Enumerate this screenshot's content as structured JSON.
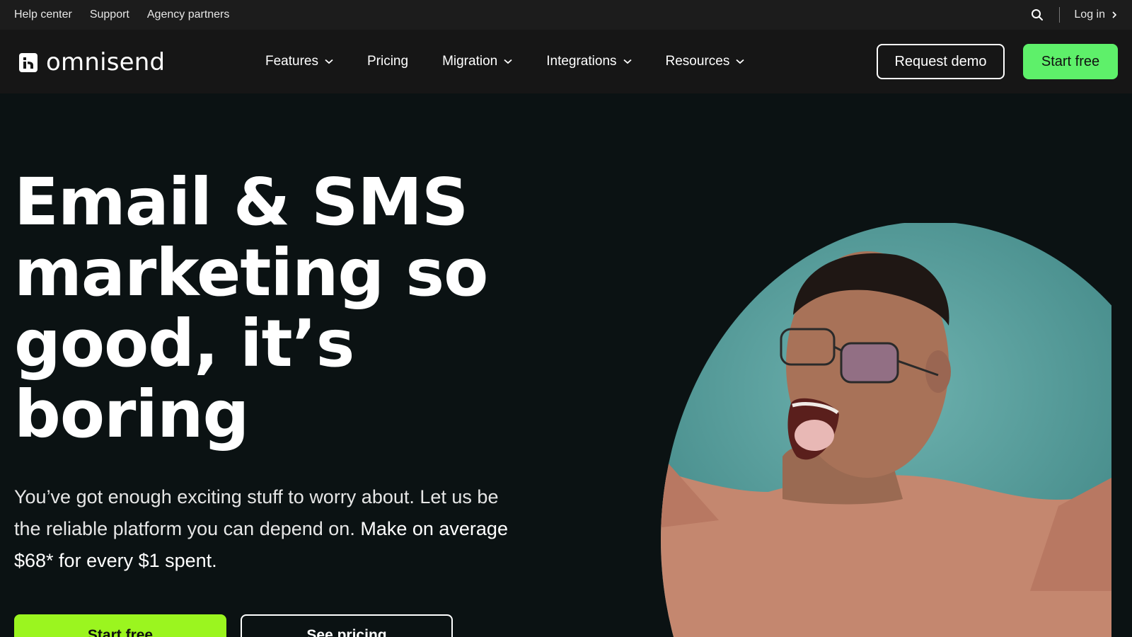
{
  "utility_bar": {
    "links": [
      "Help center",
      "Support",
      "Agency partners"
    ],
    "login_label": "Log in"
  },
  "nav": {
    "logo_text": "omnisend",
    "items": [
      {
        "label": "Features",
        "has_dropdown": true
      },
      {
        "label": "Pricing",
        "has_dropdown": false
      },
      {
        "label": "Migration",
        "has_dropdown": true
      },
      {
        "label": "Integrations",
        "has_dropdown": true
      },
      {
        "label": "Resources",
        "has_dropdown": true
      }
    ],
    "request_demo_label": "Request demo",
    "start_free_label": "Start free"
  },
  "hero": {
    "title_line1": "Email & SMS",
    "title_line2": "marketing so",
    "title_line3": "good, it’s",
    "title_line4": "boring",
    "subtitle_regular": "You’ve got enough exciting stuff to worry about. Let us be the reliable platform you can depend on. ",
    "subtitle_strong": "Make on average $68* for every $1 spent.",
    "start_free_label": "Start free",
    "see_pricing_label": "See pricing",
    "image_alt_icon": "person-photo"
  },
  "colors": {
    "page_bg": "#0b1213",
    "utility_bg": "#1c1c1c",
    "nav_bg": "#161616",
    "nav_start_button": "#5ef06a",
    "hero_start_button": "#9bf51f",
    "photo_bg": "#4f9696"
  }
}
